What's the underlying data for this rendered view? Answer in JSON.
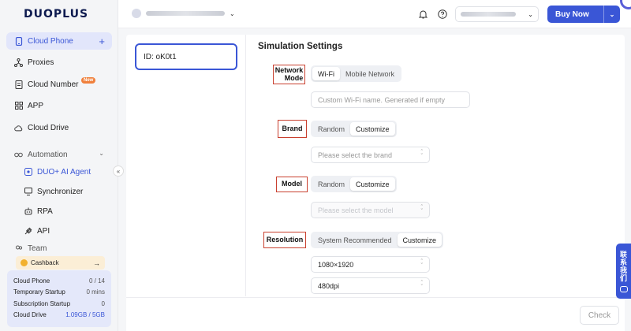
{
  "brand": {
    "logo_text": "DUOPLUS"
  },
  "sidebar": {
    "cloud_phone": "Cloud Phone",
    "proxies": "Proxies",
    "cloud_number": "Cloud Number",
    "new_badge": "New",
    "app": "APP",
    "cloud_drive": "Cloud Drive",
    "automation": "Automation",
    "ai_agent": "DUO+ AI Agent",
    "synchronizer": "Synchronizer",
    "rpa": "RPA",
    "api": "API",
    "team": "Team",
    "cashback": "Cashback",
    "usage": [
      {
        "label": "Cloud Phone",
        "value": "0 / 14"
      },
      {
        "label": "Temporary Startup",
        "value": "0 mins"
      },
      {
        "label": "Subscription Startup",
        "value": "0"
      },
      {
        "label": "Cloud Drive",
        "value": "1.09GB / 5GB"
      }
    ]
  },
  "header": {
    "buy_now": "Buy Now"
  },
  "device": {
    "id_label": "ID: oK0t1"
  },
  "settings": {
    "title": "Simulation Settings",
    "network_mode": {
      "label": "Network Mode",
      "options": [
        "Wi-Fi",
        "Mobile Network"
      ],
      "selected": "Wi-Fi",
      "wifi_placeholder": "Custom Wi-Fi name. Generated if empty"
    },
    "brand": {
      "label": "Brand",
      "options": [
        "Random",
        "Customize"
      ],
      "selected": "Customize",
      "placeholder": "Please select the brand"
    },
    "model": {
      "label": "Model",
      "options": [
        "Random",
        "Customize"
      ],
      "selected": "Customize",
      "placeholder": "Please select the model"
    },
    "resolution": {
      "label": "Resolution",
      "options": [
        "System Recommended",
        "Customize"
      ],
      "selected": "Customize",
      "size_value": "1080×1920",
      "dpi_value": "480dpi"
    }
  },
  "footer": {
    "check": "Check"
  },
  "contact": {
    "line1": "联",
    "line2": "系",
    "line3": "我",
    "line4": "们"
  },
  "colors": {
    "accent": "#3a56d6",
    "highlight_border": "#c9402f"
  }
}
